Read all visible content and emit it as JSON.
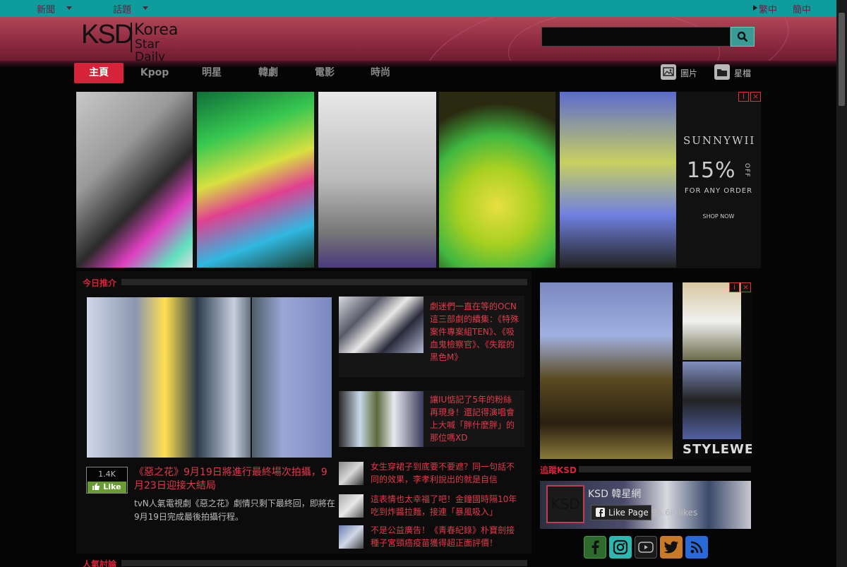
{
  "topbar": {
    "news": "新聞",
    "topics": "話題",
    "traditional": "繁中",
    "simplified": "簡中"
  },
  "logo": {
    "ksd": "KSD",
    "line1": "Korea",
    "line2": "Star Daily"
  },
  "search": {
    "value": "",
    "placeholder": ""
  },
  "nav": {
    "tabs": [
      "主頁",
      "Kpop",
      "明星",
      "韓劇",
      "電影",
      "時尚"
    ],
    "active": "主頁",
    "photos": "圖片",
    "archive": "星檔"
  },
  "banner": {
    "brand": "SUNNYWII",
    "percent": "15%",
    "off": "OFF",
    "offer": "FOR ANY ORDER",
    "cta": "SHOP NOW",
    "info": "i",
    "close": "×"
  },
  "sections": {
    "today": "今日推介",
    "popular": "人氣討論",
    "follow": "追蹤KSD"
  },
  "featured": {
    "likes": "1.4K",
    "like_label": "Like",
    "title": "《惡之花》9月19日將進行最終場次拍攝，9月23日迎接大結局",
    "desc": "tvN人氣電視劇《惡之花》劇情只剩下最終回，即將在9月19日完成最後拍攝行程。"
  },
  "cards": [
    {
      "title": "劇迷們一直在等的OCN這三部劇的續集：《特殊案件專案組TEN》、《吸血鬼檢察官》、《失蹤的黑色M》"
    },
    {
      "title": "讓IU惦記了5年的粉絲再現身！還記得演唱會上大喊「胖什麼胖」的那位嗎XD"
    }
  ],
  "items": [
    {
      "title": "女生穿裙子到底要不要遮？同一句話不同的效果，李孝利說出的就是自信"
    },
    {
      "title": "這表情也太幸福了吧！金鐘國時隔10年吃到炸醬拉麵，接連「暴風吸入」"
    },
    {
      "title": "不是公益廣告！《青春紀錄》朴寶劍接種子宮頸癌疫苗獲得超正面評價！"
    }
  ],
  "side_ad": {
    "brand": "STYLEWE",
    "info": "i",
    "close": "×"
  },
  "fb": {
    "logo": "KSD",
    "name": "KSD 韓星網",
    "like_label": "Like Page",
    "likes": "96.6K likes"
  },
  "colors": {
    "accent": "#d7233a",
    "teal": "#0f9c9c",
    "header": "#8d2a40"
  }
}
